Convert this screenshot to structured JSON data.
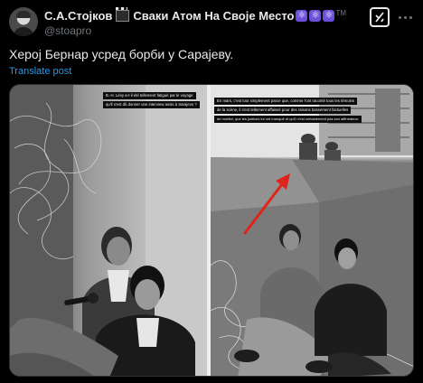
{
  "author": {
    "display_name": "С.А.Стојков",
    "name_suffix": "Сваки Атом На Своје Место",
    "badge_emojis": [
      "clapper-board-icon",
      "atom-symbol-icon",
      "atom-symbol-icon",
      "atom-symbol-icon"
    ],
    "trademark": "TM",
    "handle": "@stoapro"
  },
  "actions": {
    "grok_icon": "grok-icon",
    "more_icon": "more-options-icon"
  },
  "post": {
    "text": "Херој Бернар усред борби у Сарајеву.",
    "translate_label": "Translate post"
  },
  "media": {
    "left_page_captions": [
      "B.-H. Lévy a-t-il été tellement fatigué par le voyage",
      "qu'il s'est dû donner une interview assis à Sarajevo ?"
    ],
    "right_page_captions": [
      "En mars, c'est tout simplement parce que, comme l'ont raconté tous les témoins",
      "de la scène, il s'est tellement affaissé pour des raisons bassement factuelles",
      "de mortier, que les justices lui ont manqué et qu'il n'est certainement pas son affirmateur."
    ],
    "accent_colors": {
      "link": "#1d9bf0",
      "arrow": "#e0241b",
      "verified_badge": "#6b4fd8"
    }
  }
}
